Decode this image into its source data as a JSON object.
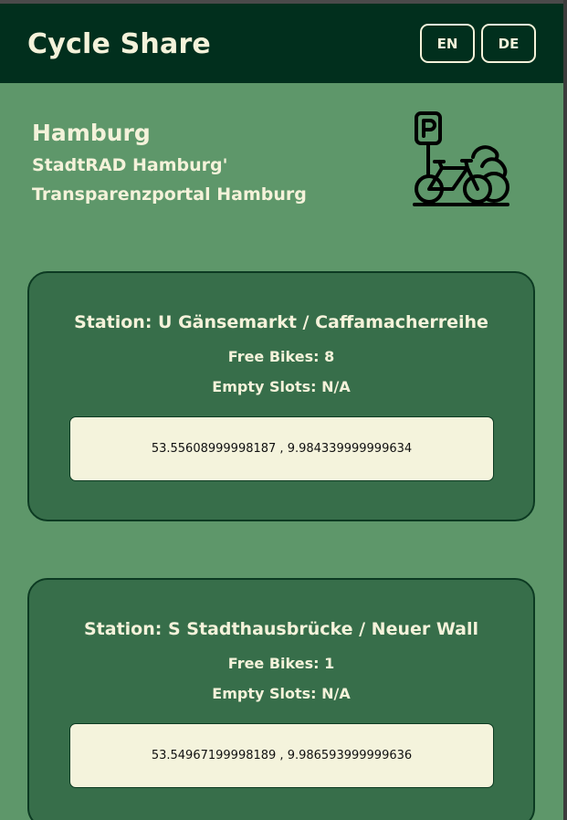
{
  "header": {
    "title": "Cycle Share",
    "languages": [
      "EN",
      "DE"
    ]
  },
  "city": {
    "name": "Hamburg",
    "provider": "StadtRAD Hamburg'",
    "source": "Transparenzportal Hamburg",
    "logo_icon": "bike-parking-icon"
  },
  "stations": [
    {
      "name": "Station: U Gänsemarkt / Caffamacherreihe",
      "free_bikes": "Free Bikes: 8",
      "empty_slots": "Empty Slots: N/A",
      "coordinates": "53.55608999998187 , 9.984339999999634"
    },
    {
      "name": "Station: S Stadthausbrücke / Neuer Wall",
      "free_bikes": "Free Bikes: 1",
      "empty_slots": "Empty Slots: N/A",
      "coordinates": "53.54967199998189 , 9.986593999999636"
    }
  ],
  "colors": {
    "header_bg": "#012f1d",
    "page_bg": "#5e976a",
    "card_bg": "#376e4a",
    "text_light": "#f4f2da",
    "coords_bg": "#f4f3dc"
  }
}
